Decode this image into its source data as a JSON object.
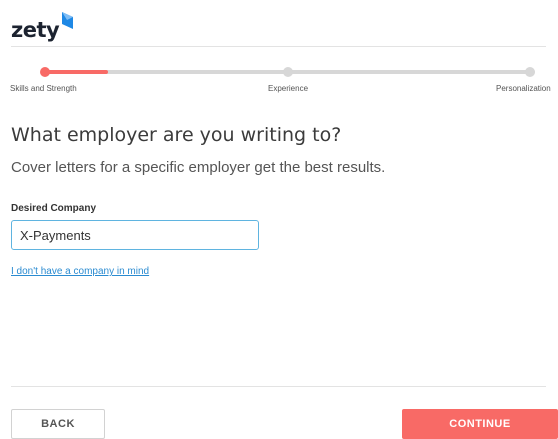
{
  "brand": {
    "name": "zety",
    "logo_icon": "zety-logo-mark-icon",
    "mark_color": "#1e88e5"
  },
  "progress": {
    "steps": [
      {
        "label": "Skills and Strength",
        "state": "active"
      },
      {
        "label": "Experience",
        "state": "upcoming"
      },
      {
        "label": "Personalization",
        "state": "upcoming"
      }
    ],
    "active_color": "#f86a66",
    "inactive_color": "#d7d7d7"
  },
  "main": {
    "heading": "What employer are you writing to?",
    "subheading": "Cover letters for a specific employer get the best results.",
    "company_field": {
      "label": "Desired Company",
      "value": "X-Payments"
    },
    "no_company_link": "I don't have a company in mind"
  },
  "footer": {
    "back_label": "BACK",
    "continue_label": "CONTINUE",
    "continue_color": "#f86a66"
  }
}
